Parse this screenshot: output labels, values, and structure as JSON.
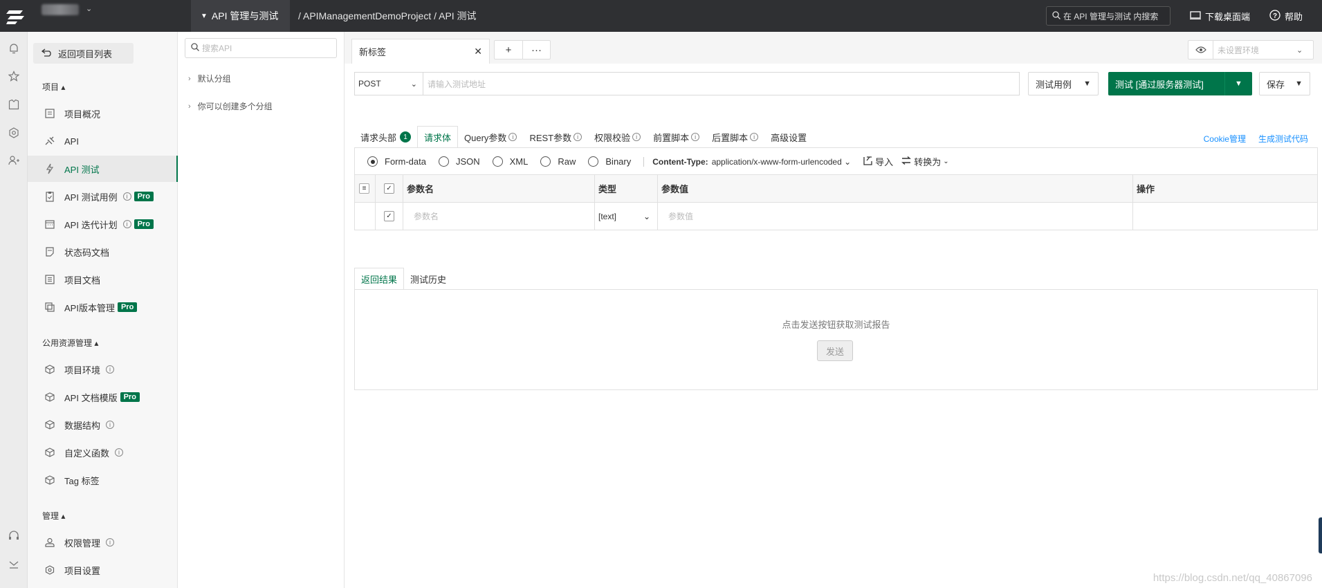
{
  "topbar": {
    "module": "API 管理与测试",
    "breadcrumb": "/ APIManagementDemoProject / API 测试",
    "search_placeholder": "在 API 管理与测试 内搜索",
    "download": "下载桌面端",
    "help": "帮助"
  },
  "sidebar": {
    "back": "返回项目列表",
    "sections": [
      {
        "title": "项目"
      },
      {
        "title": "公用资源管理"
      },
      {
        "title": "管理"
      }
    ],
    "items": [
      {
        "label": "项目概况"
      },
      {
        "label": "API"
      },
      {
        "label": "API 测试"
      },
      {
        "label": "API 测试用例",
        "pro": "Pro"
      },
      {
        "label": "API 迭代计划",
        "pro": "Pro"
      },
      {
        "label": "状态码文档"
      },
      {
        "label": "项目文档"
      },
      {
        "label": "API版本管理",
        "pro": "Pro"
      },
      {
        "label": "项目环境"
      },
      {
        "label": "API 文档模版",
        "pro": "Pro"
      },
      {
        "label": "数据结构"
      },
      {
        "label": "自定义函数"
      },
      {
        "label": "Tag 标签"
      },
      {
        "label": "权限管理"
      },
      {
        "label": "项目设置"
      }
    ]
  },
  "tree": {
    "search_placeholder": "搜索API",
    "groups": [
      "默认分组",
      "你可以创建多个分组"
    ]
  },
  "tabs": {
    "current": "新标签",
    "add": "+",
    "more": "···"
  },
  "env": {
    "placeholder": "未设置环境"
  },
  "request": {
    "method": "POST",
    "url_placeholder": "请输入测试地址",
    "case_btn": "测试用例",
    "test_btn": "测试 [通过服务器测试]",
    "save_btn": "保存"
  },
  "param_tabs": [
    {
      "label": "请求头部",
      "badge": "1"
    },
    {
      "label": "请求体"
    },
    {
      "label": "Query参数"
    },
    {
      "label": "REST参数"
    },
    {
      "label": "权限校验"
    },
    {
      "label": "前置脚本"
    },
    {
      "label": "后置脚本"
    },
    {
      "label": "高级设置"
    }
  ],
  "links": {
    "cookie": "Cookie管理",
    "gen_code": "生成测试代码"
  },
  "body_types": [
    "Form-data",
    "JSON",
    "XML",
    "Raw",
    "Binary"
  ],
  "content_type": {
    "label": "Content-Type:",
    "value": "application/x-www-form-urlencoded"
  },
  "import": "导入",
  "convert": "转换为",
  "grid": {
    "headers": [
      "参数名",
      "类型",
      "参数值",
      "操作"
    ],
    "row": {
      "name_placeholder": "参数名",
      "type": "[text]",
      "value_placeholder": "参数值"
    }
  },
  "result_tabs": [
    "返回结果",
    "测试历史"
  ],
  "result": {
    "message": "点击发送按钮获取测试报告",
    "send": "发送"
  },
  "watermark": "https://blog.csdn.net/qq_40867096",
  "colors": {
    "accent": "#00754a",
    "topbar": "#2f3033",
    "link": "#1890ff"
  }
}
